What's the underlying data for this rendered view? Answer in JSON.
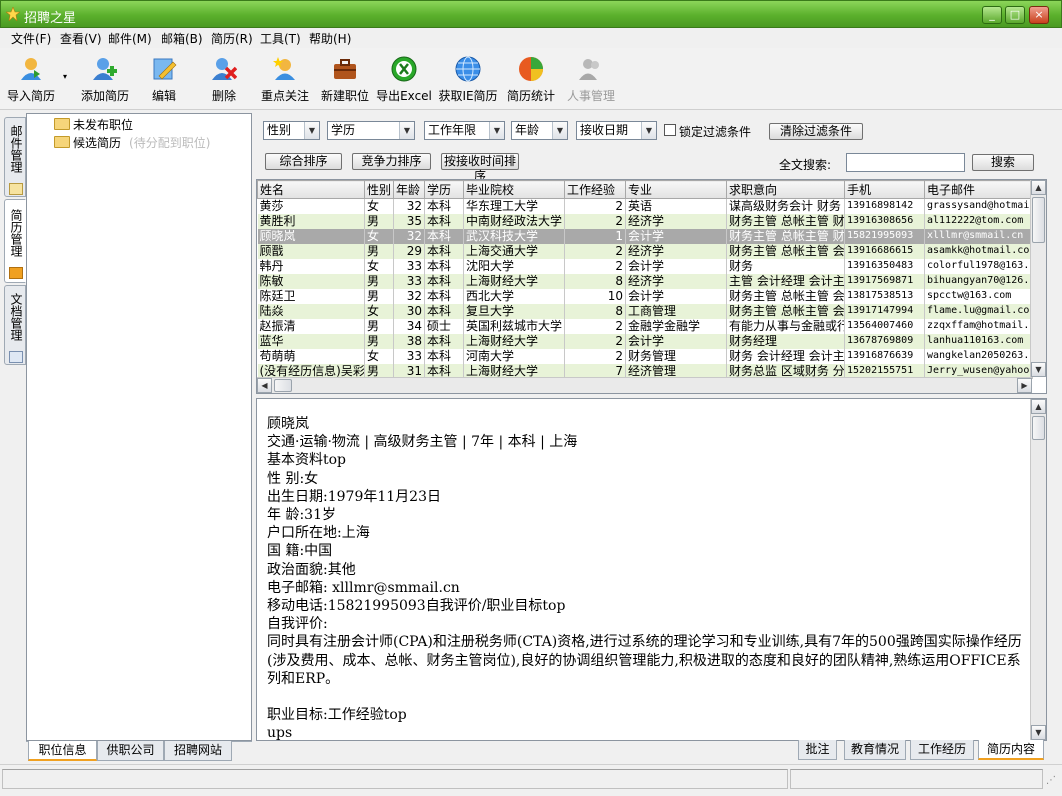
{
  "window": {
    "title": "招聘之星",
    "minimize": "_",
    "maximize": "□",
    "close": "×"
  },
  "menu": [
    "文件(F)",
    "查看(V)",
    "邮件(M)",
    "邮箱(B)",
    "简历(R)",
    "工具(T)",
    "帮助(H)"
  ],
  "toolbar": {
    "import": "导入简历",
    "add_position": "添加简历",
    "edit": "编辑",
    "delete": "删除",
    "focus": "重点关注",
    "new_position": "新建职位",
    "export_excel": "导出Excel",
    "get_ie": "获取IE简历",
    "stats": "简历统计",
    "hr": "人事管理"
  },
  "side_tabs": [
    "邮件管理",
    "简历管理",
    "文档管理"
  ],
  "tree": {
    "unpublished": "未发布职位",
    "candidates": "候选简历",
    "candidates_hint": "(待分配到职位)"
  },
  "left_bottom_tabs": [
    "职位信息",
    "供职公司",
    "招聘网站"
  ],
  "filter": {
    "gender": "性别",
    "education": "学历",
    "years": "工作年限",
    "age": "年龄",
    "received_date": "接收日期",
    "lock_label": "锁定过滤条件",
    "clear": "清除过滤条件",
    "sort_all": "综合排序",
    "sort_compete": "竞争力排序",
    "sort_time": "按接收时间排序",
    "search_label": "全文搜索:",
    "search_button": "搜索",
    "search_value": ""
  },
  "table": {
    "columns": [
      "姓名",
      "性别",
      "年龄",
      "学历",
      "毕业院校",
      "工作经验",
      "专业",
      "求职意向",
      "手机",
      "电子邮件"
    ],
    "rows": [
      [
        "黄莎",
        "女",
        "32",
        "本科",
        "华东理工大学",
        "2",
        "英语",
        "谋高级财务会计 财务",
        "13916898142",
        "grassysand@hotmai"
      ],
      [
        "黄胜利",
        "男",
        "35",
        "本科",
        "中南财经政法大学",
        "2",
        "经济学",
        "财务主管 总帐主管 财",
        "13916308656",
        "al112222@tom.com"
      ],
      [
        "顾晓岚",
        "女",
        "32",
        "本科",
        "武汉科技大学",
        "1",
        "会计学",
        "财务主管 总帐主管 财",
        "15821995093",
        "xlllmr@smmail.cn"
      ],
      [
        "顾戬",
        "男",
        "29",
        "本科",
        "上海交通大学",
        "2",
        "经济学",
        "财务主管 总帐主管 会",
        "13916686615",
        "asamkk@hotmail.co"
      ],
      [
        "韩丹",
        "女",
        "33",
        "本科",
        "沈阳大学",
        "2",
        "会计学",
        "财务",
        "13916350483",
        "colorful1978@163."
      ],
      [
        "陈敏",
        "男",
        "33",
        "本科",
        "上海财经大学",
        "8",
        "经济学",
        "主管 会计经理 会计主",
        "13917569871",
        "bihuangyan70@126."
      ],
      [
        "陈廷卫",
        "男",
        "32",
        "本科",
        "西北大学",
        "10",
        "会计学",
        "财务主管 总帐主管 会",
        "13817538513",
        "spcctw@163.com"
      ],
      [
        "陆焱",
        "女",
        "30",
        "本科",
        "复旦大学",
        "8",
        "工商管理",
        "财务主管 总帐主管 会",
        "13917147994",
        "flame.lu@gmail.co"
      ],
      [
        "赵振清",
        "男",
        "34",
        "硕士",
        "英国利兹城市大学",
        "2",
        "金融学金融学",
        "有能力从事与金融或行",
        "13564007460",
        "zzqxffam@hotmail."
      ],
      [
        "蓝华",
        "男",
        "38",
        "本科",
        "上海财经大学",
        "2",
        "会计学",
        "财务经理",
        "13678769809",
        "lanhua110163.com"
      ],
      [
        "苟萌萌",
        "女",
        "33",
        "本科",
        "河南大学",
        "2",
        "财务管理",
        "财务 会计经理 会计主",
        "13916876639",
        "wangkelan2050263."
      ],
      [
        "(没有经历信息)吴彩",
        "男",
        "31",
        "本科",
        "上海财经大学",
        "7",
        "经济管理",
        "财务总监 区域财务 分",
        "15202155751",
        "Jerry_wusen@yahoo"
      ]
    ],
    "selected_row": 2
  },
  "detail": {
    "text": "顾晓岚\n交通·运输·物流 | 高级财务主管 | 7年 | 本科 | 上海\n基本资料top\n性 别:女\n出生日期:1979年11月23日\n年 龄:31岁\n户口所在地:上海\n国 籍:中国\n政治面貌:其他\n电子邮箱: xlllmr@smmail.cn\n移动电话:15821995093自我评价/职业目标top\n自我评价:\n同时具有注册会计师(CPA)和注册税务师(CTA)资格,进行过系统的理论学习和专业训练,具有7年的500强跨国实际操作经历(涉及费用、成本、总帐、财务主管岗位),良好的协调组织管理能力,积极进取的态度和良好的团队精神,熟练运用OFFICE系列和ERP。\n\n职业目标:工作经验top\nups"
  },
  "right_bottom_tabs": [
    "批注",
    "教育情况",
    "工作经历",
    "简历内容"
  ],
  "colors": {
    "title_green": "#5bb02c",
    "row_alt": "#e8f3d8",
    "row_selected": "#a9a9a9",
    "tab_accent": "#f0a020"
  }
}
